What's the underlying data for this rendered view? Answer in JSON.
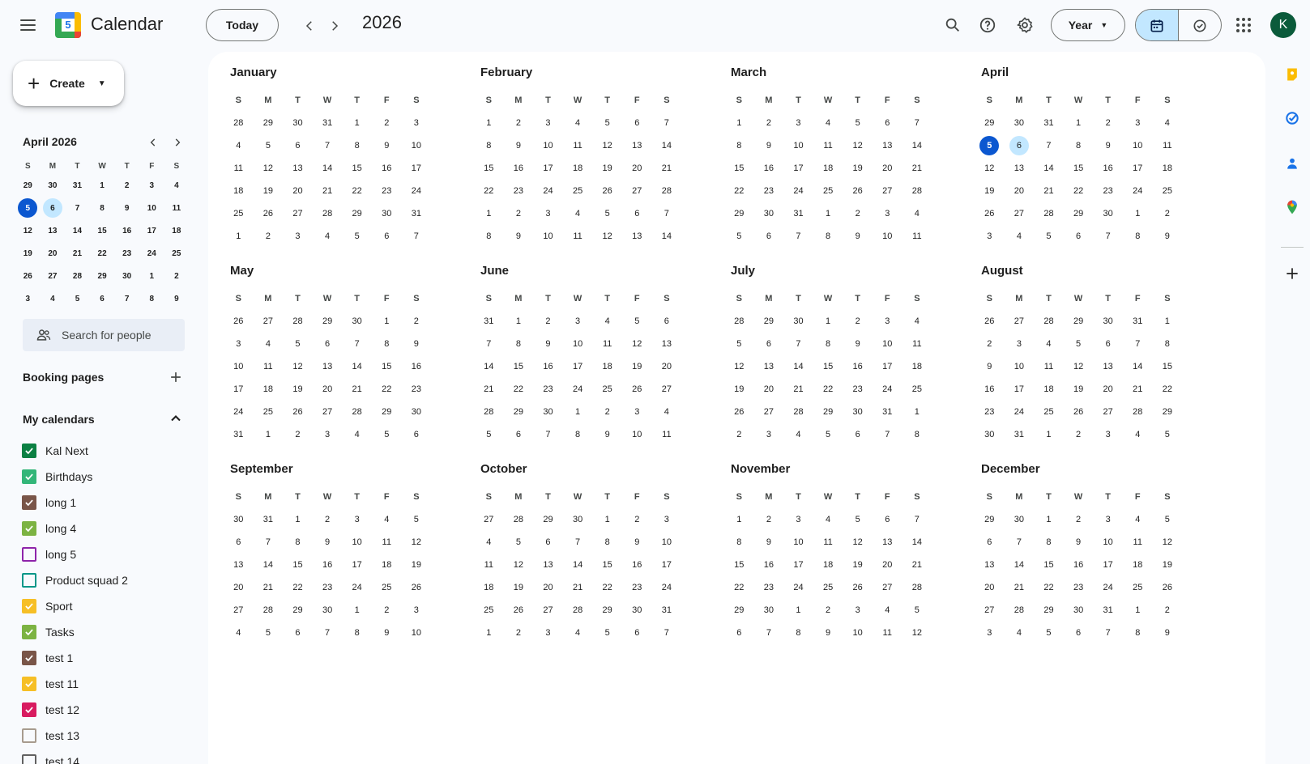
{
  "header": {
    "app_title": "Calendar",
    "logo_number": "5",
    "today_label": "Today",
    "year_title": "2026",
    "view_label": "Year",
    "avatar_letter": "K",
    "icons": [
      "menu-icon",
      "chevron-left-icon",
      "chevron-right-icon",
      "search-icon",
      "help-icon",
      "settings-icon",
      "calendar-icon",
      "tasks-check-icon",
      "apps-grid-icon"
    ]
  },
  "sidebar": {
    "create_label": "Create",
    "mini_calendar": {
      "title": "April 2026",
      "weekdays": [
        "S",
        "M",
        "T",
        "W",
        "T",
        "F",
        "S"
      ],
      "days": [
        [
          "29",
          "30",
          "31",
          "1",
          "2",
          "3",
          "4"
        ],
        [
          "5",
          "6",
          "7",
          "8",
          "9",
          "10",
          "11"
        ],
        [
          "12",
          "13",
          "14",
          "15",
          "16",
          "17",
          "18"
        ],
        [
          "19",
          "20",
          "21",
          "22",
          "23",
          "24",
          "25"
        ],
        [
          "26",
          "27",
          "28",
          "29",
          "30",
          "1",
          "2"
        ],
        [
          "3",
          "4",
          "5",
          "6",
          "7",
          "8",
          "9"
        ]
      ],
      "today": "5",
      "selected": "6"
    },
    "search_people_placeholder": "Search for people",
    "booking_pages_label": "Booking pages",
    "my_calendars_label": "My calendars",
    "calendars": [
      {
        "name": "Kal Next",
        "color": "#0b8043",
        "checked": true
      },
      {
        "name": "Birthdays",
        "color": "#33b679",
        "checked": true
      },
      {
        "name": "long 1",
        "color": "#795548",
        "checked": true
      },
      {
        "name": "long 4",
        "color": "#7cb342",
        "checked": true
      },
      {
        "name": "long 5",
        "color": "#8e24aa",
        "checked": false
      },
      {
        "name": "Product squad 2",
        "color": "#009688",
        "checked": false
      },
      {
        "name": "Sport",
        "color": "#f6bf26",
        "checked": true
      },
      {
        "name": "Tasks",
        "color": "#7cb342",
        "checked": true
      },
      {
        "name": "test 1",
        "color": "#795548",
        "checked": true
      },
      {
        "name": "test 11",
        "color": "#f6bf26",
        "checked": true
      },
      {
        "name": "test 12",
        "color": "#d81b60",
        "checked": true
      },
      {
        "name": "test 13",
        "color": "#a79b8e",
        "checked": false
      },
      {
        "name": "test 14",
        "color": "#616161",
        "checked": false
      }
    ]
  },
  "year_view": {
    "weekdays": [
      "S",
      "M",
      "T",
      "W",
      "T",
      "F",
      "S"
    ],
    "months": [
      {
        "name": "January",
        "days": [
          "28",
          "29",
          "30",
          "31",
          "1",
          "2",
          "3",
          "4",
          "5",
          "6",
          "7",
          "8",
          "9",
          "10",
          "11",
          "12",
          "13",
          "14",
          "15",
          "16",
          "17",
          "18",
          "19",
          "20",
          "21",
          "22",
          "23",
          "24",
          "25",
          "26",
          "27",
          "28",
          "29",
          "30",
          "31",
          "1",
          "2",
          "3",
          "4",
          "5",
          "6",
          "7"
        ]
      },
      {
        "name": "February",
        "days": [
          "1",
          "2",
          "3",
          "4",
          "5",
          "6",
          "7",
          "8",
          "9",
          "10",
          "11",
          "12",
          "13",
          "14",
          "15",
          "16",
          "17",
          "18",
          "19",
          "20",
          "21",
          "22",
          "23",
          "24",
          "25",
          "26",
          "27",
          "28",
          "1",
          "2",
          "3",
          "4",
          "5",
          "6",
          "7",
          "8",
          "9",
          "10",
          "11",
          "12",
          "13",
          "14"
        ]
      },
      {
        "name": "March",
        "days": [
          "1",
          "2",
          "3",
          "4",
          "5",
          "6",
          "7",
          "8",
          "9",
          "10",
          "11",
          "12",
          "13",
          "14",
          "15",
          "16",
          "17",
          "18",
          "19",
          "20",
          "21",
          "22",
          "23",
          "24",
          "25",
          "26",
          "27",
          "28",
          "29",
          "30",
          "31",
          "1",
          "2",
          "3",
          "4",
          "5",
          "6",
          "7",
          "8",
          "9",
          "10",
          "11"
        ]
      },
      {
        "name": "April",
        "days": [
          "29",
          "30",
          "31",
          "1",
          "2",
          "3",
          "4",
          "5",
          "6",
          "7",
          "8",
          "9",
          "10",
          "11",
          "12",
          "13",
          "14",
          "15",
          "16",
          "17",
          "18",
          "19",
          "20",
          "21",
          "22",
          "23",
          "24",
          "25",
          "26",
          "27",
          "28",
          "29",
          "30",
          "1",
          "2",
          "3",
          "4",
          "5",
          "6",
          "7",
          "8",
          "9"
        ],
        "today": "5",
        "selected": "6"
      },
      {
        "name": "May",
        "days": [
          "26",
          "27",
          "28",
          "29",
          "30",
          "1",
          "2",
          "3",
          "4",
          "5",
          "6",
          "7",
          "8",
          "9",
          "10",
          "11",
          "12",
          "13",
          "14",
          "15",
          "16",
          "17",
          "18",
          "19",
          "20",
          "21",
          "22",
          "23",
          "24",
          "25",
          "26",
          "27",
          "28",
          "29",
          "30",
          "31",
          "1",
          "2",
          "3",
          "4",
          "5",
          "6"
        ]
      },
      {
        "name": "June",
        "days": [
          "31",
          "1",
          "2",
          "3",
          "4",
          "5",
          "6",
          "7",
          "8",
          "9",
          "10",
          "11",
          "12",
          "13",
          "14",
          "15",
          "16",
          "17",
          "18",
          "19",
          "20",
          "21",
          "22",
          "23",
          "24",
          "25",
          "26",
          "27",
          "28",
          "29",
          "30",
          "1",
          "2",
          "3",
          "4",
          "5",
          "6",
          "7",
          "8",
          "9",
          "10",
          "11"
        ]
      },
      {
        "name": "July",
        "days": [
          "28",
          "29",
          "30",
          "1",
          "2",
          "3",
          "4",
          "5",
          "6",
          "7",
          "8",
          "9",
          "10",
          "11",
          "12",
          "13",
          "14",
          "15",
          "16",
          "17",
          "18",
          "19",
          "20",
          "21",
          "22",
          "23",
          "24",
          "25",
          "26",
          "27",
          "28",
          "29",
          "30",
          "31",
          "1",
          "2",
          "3",
          "4",
          "5",
          "6",
          "7",
          "8"
        ]
      },
      {
        "name": "August",
        "days": [
          "26",
          "27",
          "28",
          "29",
          "30",
          "31",
          "1",
          "2",
          "3",
          "4",
          "5",
          "6",
          "7",
          "8",
          "9",
          "10",
          "11",
          "12",
          "13",
          "14",
          "15",
          "16",
          "17",
          "18",
          "19",
          "20",
          "21",
          "22",
          "23",
          "24",
          "25",
          "26",
          "27",
          "28",
          "29",
          "30",
          "31",
          "1",
          "2",
          "3",
          "4",
          "5"
        ]
      },
      {
        "name": "September",
        "days": [
          "30",
          "31",
          "1",
          "2",
          "3",
          "4",
          "5",
          "6",
          "7",
          "8",
          "9",
          "10",
          "11",
          "12",
          "13",
          "14",
          "15",
          "16",
          "17",
          "18",
          "19",
          "20",
          "21",
          "22",
          "23",
          "24",
          "25",
          "26",
          "27",
          "28",
          "29",
          "30",
          "1",
          "2",
          "3",
          "4",
          "5",
          "6",
          "7",
          "8",
          "9",
          "10"
        ]
      },
      {
        "name": "October",
        "days": [
          "27",
          "28",
          "29",
          "30",
          "1",
          "2",
          "3",
          "4",
          "5",
          "6",
          "7",
          "8",
          "9",
          "10",
          "11",
          "12",
          "13",
          "14",
          "15",
          "16",
          "17",
          "18",
          "19",
          "20",
          "21",
          "22",
          "23",
          "24",
          "25",
          "26",
          "27",
          "28",
          "29",
          "30",
          "31",
          "1",
          "2",
          "3",
          "4",
          "5",
          "6",
          "7"
        ]
      },
      {
        "name": "November",
        "days": [
          "1",
          "2",
          "3",
          "4",
          "5",
          "6",
          "7",
          "8",
          "9",
          "10",
          "11",
          "12",
          "13",
          "14",
          "15",
          "16",
          "17",
          "18",
          "19",
          "20",
          "21",
          "22",
          "23",
          "24",
          "25",
          "26",
          "27",
          "28",
          "29",
          "30",
          "1",
          "2",
          "3",
          "4",
          "5",
          "6",
          "7",
          "8",
          "9",
          "10",
          "11",
          "12"
        ]
      },
      {
        "name": "December",
        "days": [
          "29",
          "30",
          "1",
          "2",
          "3",
          "4",
          "5",
          "6",
          "7",
          "8",
          "9",
          "10",
          "11",
          "12",
          "13",
          "14",
          "15",
          "16",
          "17",
          "18",
          "19",
          "20",
          "21",
          "22",
          "23",
          "24",
          "25",
          "26",
          "27",
          "28",
          "29",
          "30",
          "31",
          "1",
          "2",
          "3",
          "4",
          "5",
          "6",
          "7",
          "8",
          "9"
        ]
      }
    ]
  },
  "right_rail": {
    "icons": [
      "keep-icon",
      "tasks-icon",
      "contacts-icon",
      "maps-icon",
      "add-icon"
    ],
    "colors": {
      "keep": "#fbbc04",
      "tasks": "#1a73e8",
      "contacts": "#1a73e8"
    }
  }
}
